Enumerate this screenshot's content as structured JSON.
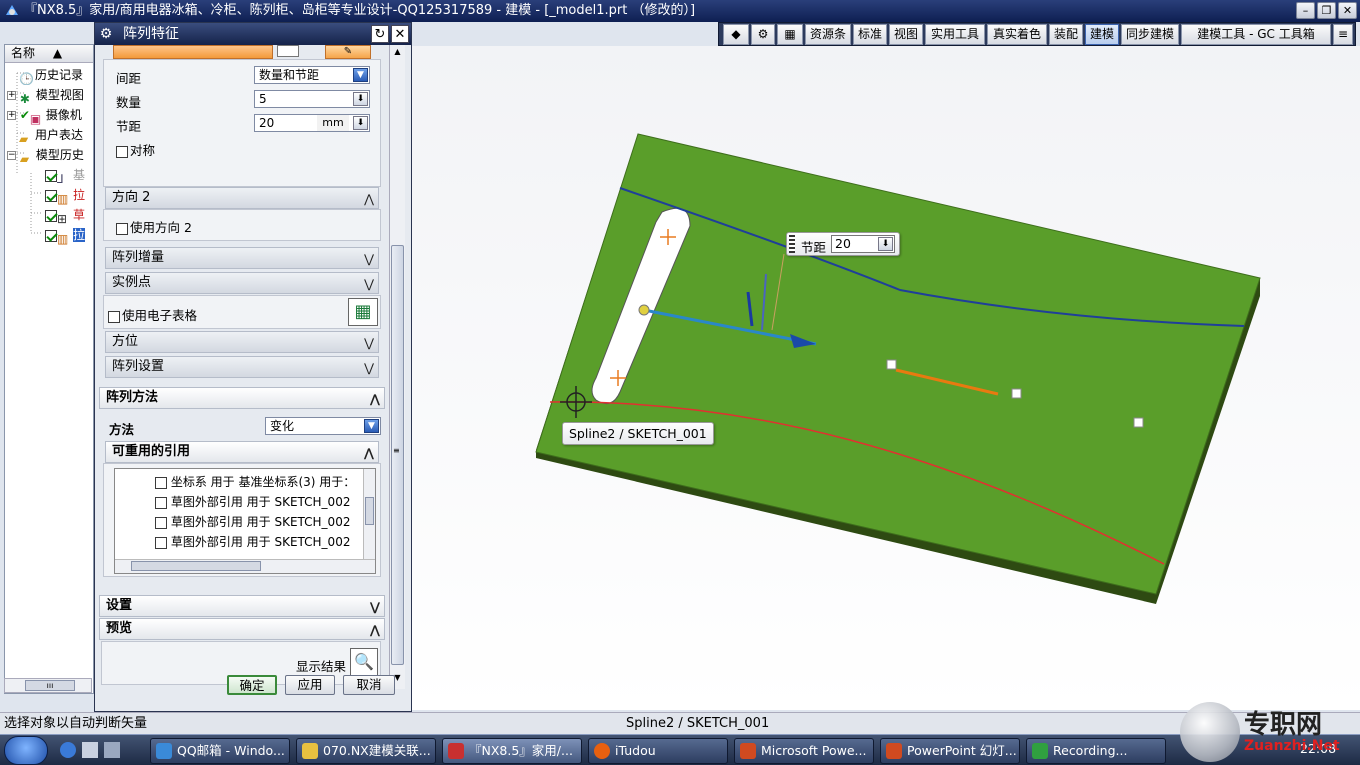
{
  "window": {
    "title": "『NX8.5』家用/商用电器冰箱、冷柜、陈列柜、岛柜等专业设计-QQ125317589 - 建模 - [_model1.prt （修改的）]"
  },
  "toolbar": {
    "items": [
      "资源条",
      "标准",
      "视图",
      "实用工具",
      "真实着色",
      "装配",
      "建模",
      "同步建模",
      "建模工具 - GC 工具箱"
    ],
    "active": "建模"
  },
  "navigator": {
    "header": "名称",
    "items": [
      "历史记录",
      "模型视图",
      "摄像机",
      "用户表达",
      "模型历史",
      "基",
      "拉",
      "草",
      "拉"
    ]
  },
  "dialog": {
    "title": "阵列特征",
    "spacing_label": "间距",
    "spacing_value": "数量和节距",
    "count_label": "数量",
    "count_value": "5",
    "pitch_label": "节距",
    "pitch_value": "20",
    "pitch_unit": "mm",
    "symmetric_label": "对称",
    "dir2_header": "方向 2",
    "use_dir2_label": "使用方向 2",
    "increment_header": "阵列增量",
    "instance_header": "实例点",
    "spreadsheet_label": "使用电子表格",
    "orientation_header": "方位",
    "settings_header": "阵列设置",
    "method_section": "阵列方法",
    "method_label": "方法",
    "method_value": "变化",
    "refs_header": "可重用的引用",
    "refs": [
      "坐标系 用于 基准坐标系(3) 用于：",
      "草图外部引用 用于 SKETCH_002",
      "草图外部引用 用于 SKETCH_002",
      "草图外部引用 用于 SKETCH_002"
    ],
    "settings2_header": "设置",
    "preview_header": "预览",
    "show_result_label": "显示结果",
    "ok": "确定",
    "apply": "应用",
    "cancel": "取消"
  },
  "viewport": {
    "pitch_label": "节距",
    "pitch_value": "20",
    "spline_tooltip": "Spline2 / SKETCH_001",
    "plate_color": "#5a9e2a"
  },
  "status": {
    "prompt": "选择对象以自动判断矢量",
    "selection": "Spline2 / SKETCH_001"
  },
  "taskbar": {
    "tasks": [
      "QQ邮箱 - Windo...",
      "070.NX建模关联...",
      "『NX8.5』家用/...",
      "iTudou",
      "Microsoft Powe...",
      "PowerPoint 幻灯...",
      "Recording..."
    ],
    "clock": "22:08"
  },
  "watermark": {
    "text": "专职网",
    "url": "Zuanzhi.Net"
  }
}
